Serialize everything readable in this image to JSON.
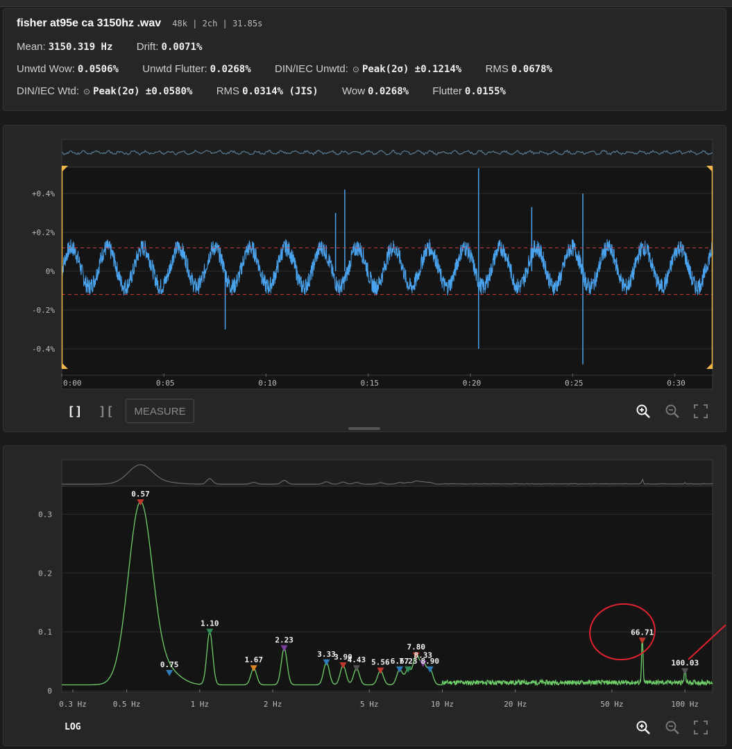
{
  "file": {
    "name": "fisher at95e ca 3150hz .wav",
    "meta": "48k | 2ch | 31.85s"
  },
  "stats": {
    "mean_label": "Mean:",
    "mean_value": "3150.319 Hz",
    "drift_label": "Drift:",
    "drift_value": "0.0071%",
    "unwtd_wow_label": "Unwtd Wow:",
    "unwtd_wow_value": "0.0506%",
    "unwtd_flutter_label": "Unwtd Flutter:",
    "unwtd_flutter_value": "0.0268%",
    "din_unwtd_label": "DIN/IEC Unwtd:",
    "din_unwtd_peak": "Peak(2σ) ±0.1214%",
    "rms_label": "RMS",
    "rms_unwtd_value": "0.0678%",
    "din_wtd_label": "DIN/IEC Wtd:",
    "din_wtd_peak": "Peak(2σ) ±0.0580%",
    "rms_wtd_value": "0.0314% (JIS)",
    "wow_label": "Wow",
    "wow_value": "0.0268%",
    "flutter_label": "Flutter",
    "flutter_value": "0.0155%"
  },
  "waveform": {
    "y_ticks": [
      "+0.4%",
      "+0.2%",
      "0%",
      "-0.2%",
      "-0.4%"
    ],
    "x_ticks": [
      "0:00",
      "0:05",
      "0:10",
      "0:15",
      "0:20",
      "0:25",
      "0:30"
    ],
    "trace_color": "#4aa3ee",
    "threshold_color": "#d03a3a",
    "buttons": {
      "select_all": "[]",
      "trim": "][",
      "measure": "MEASURE"
    }
  },
  "spectrum": {
    "y_ticks": [
      "0.3",
      "0.2",
      "0.1",
      "0"
    ],
    "x_ticks": [
      "0.3 Hz",
      "0.5 Hz",
      "1 Hz",
      "2 Hz",
      "5 Hz",
      "10 Hz",
      "20 Hz",
      "50 Hz",
      "100 Hz"
    ],
    "scale_label": "LOG",
    "trace_color": "#6fd06a",
    "annotation_color": "#e0232e"
  },
  "chart_data": [
    {
      "type": "line",
      "title": "",
      "xlabel": "",
      "ylabel": "",
      "x_unit": "seconds",
      "xlim": [
        0,
        31.85
      ],
      "y_unit": "percent deviation",
      "ylim": [
        -0.5,
        0.5
      ],
      "x_ticks": [
        "0:00",
        "0:05",
        "0:10",
        "0:15",
        "0:20",
        "0:25",
        "0:30"
      ],
      "y_ticks": [
        "+0.4%",
        "+0.2%",
        "0%",
        "-0.2%",
        "-0.4%"
      ],
      "dominant_period_s": 1.75,
      "threshold_lines": [
        0.12,
        -0.12
      ],
      "spikes": [
        {
          "t": 13.4,
          "v": 0.3
        },
        {
          "t": 13.85,
          "v": 0.42
        },
        {
          "t": 20.4,
          "v": 0.53
        },
        {
          "t": 20.4,
          "v": -0.4
        },
        {
          "t": 23.0,
          "v": 0.33
        },
        {
          "t": 25.5,
          "v": 0.4
        },
        {
          "t": 25.5,
          "v": -0.48
        },
        {
          "t": 8.0,
          "v": -0.3
        }
      ]
    },
    {
      "type": "line",
      "title": "",
      "xlabel": "",
      "ylabel": "",
      "x_scale": "log",
      "x_unit": "Hz",
      "xlim": [
        0.27,
        130
      ],
      "ylim": [
        0,
        0.35
      ],
      "x_ticks": [
        "0.3 Hz",
        "0.5 Hz",
        "1 Hz",
        "2 Hz",
        "5 Hz",
        "10 Hz",
        "20 Hz",
        "50 Hz",
        "100 Hz"
      ],
      "y_ticks": [
        "0.3",
        "0.2",
        "0.1",
        "0"
      ],
      "peaks": [
        {
          "freq": 0.57,
          "value": 0.31,
          "label": "0.57",
          "marker": "#c0392b"
        },
        {
          "freq": 0.75,
          "value": 0.02,
          "label": "0.75",
          "marker": "#2e7bb8"
        },
        {
          "freq": 1.1,
          "value": 0.09,
          "label": "1.10",
          "marker": "#2e8b57"
        },
        {
          "freq": 1.67,
          "value": 0.028,
          "label": "1.67",
          "marker": "#d98324"
        },
        {
          "freq": 2.23,
          "value": 0.062,
          "label": "2.23",
          "marker": "#7b3fa0"
        },
        {
          "freq": 3.33,
          "value": 0.038,
          "label": "3.33",
          "marker": "#2e7bb8"
        },
        {
          "freq": 3.9,
          "value": 0.033,
          "label": "3.90",
          "marker": "#c0392b"
        },
        {
          "freq": 4.43,
          "value": 0.028,
          "label": "4.43",
          "marker": "#555555"
        },
        {
          "freq": 5.56,
          "value": 0.024,
          "label": "5.56",
          "marker": "#c0392b"
        },
        {
          "freq": 6.67,
          "value": 0.026,
          "label": "6.67",
          "marker": "#2e7bb8"
        },
        {
          "freq": 7.23,
          "value": 0.026,
          "label": "7.23",
          "marker": "#2e8b57"
        },
        {
          "freq": 7.8,
          "value": 0.05,
          "label": "7.80",
          "marker": "#c0392b"
        },
        {
          "freq": 8.33,
          "value": 0.036,
          "label": "8.33",
          "marker": "#7b3fa0"
        },
        {
          "freq": 8.9,
          "value": 0.026,
          "label": "8.90",
          "marker": "#2e7bb8"
        },
        {
          "freq": 66.71,
          "value": 0.075,
          "label": "66.71",
          "marker": "#c0392b"
        },
        {
          "freq": 100.03,
          "value": 0.023,
          "label": "100.03",
          "marker": "#555555"
        }
      ]
    }
  ]
}
